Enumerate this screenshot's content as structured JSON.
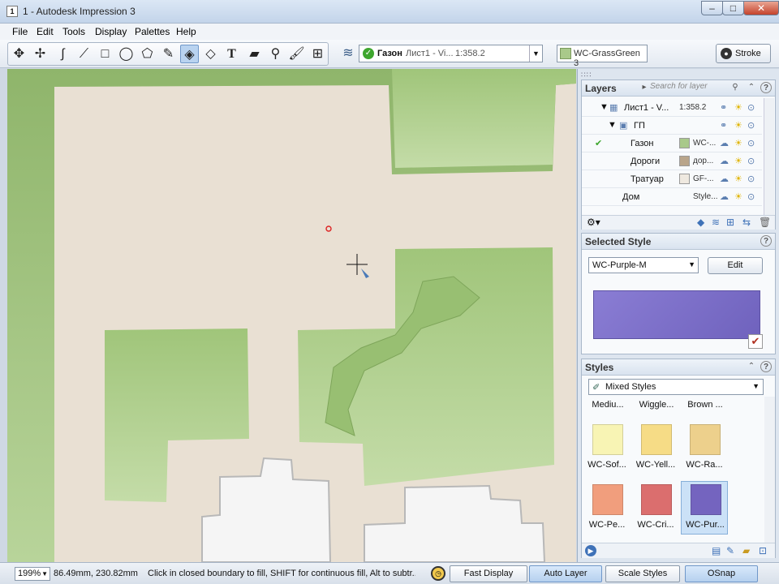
{
  "window": {
    "title": "1 - Autodesk Impression 3",
    "min": "–",
    "max": "□",
    "close": "✕",
    "app_glyph": "1"
  },
  "menu": [
    "File",
    "Edit",
    "Tools",
    "Display",
    "Palettes",
    "Help"
  ],
  "toolbar": {
    "tools": [
      "select-arrow-icon",
      "node-edit-icon",
      "freehand-curve-icon",
      "line-icon",
      "rectangle-icon",
      "ellipse-icon",
      "polygon-icon",
      "pen-icon",
      "paint-bucket-icon",
      "fill-cross-icon",
      "text-icon",
      "eraser-icon",
      "zoom-icon",
      "brush-icon",
      "align-icon"
    ],
    "layer_combo": {
      "name": "Газон",
      "sheet": "Лист1 - Vi...",
      "scale": "1:358.2"
    },
    "style_name": "WC-GrassGreen 3",
    "stroke_label": "Stroke"
  },
  "layers": {
    "title": "Layers",
    "search_placeholder": "Search for layer",
    "rows": [
      {
        "name": "Лист1 - V...",
        "style": "1:358.2",
        "indent": 0,
        "swatch": ""
      },
      {
        "name": "ГП",
        "style": "",
        "indent": 1,
        "swatch": ""
      },
      {
        "name": "Газон",
        "style": "WC-...",
        "indent": 2,
        "swatch": "#a9c98a",
        "active": true
      },
      {
        "name": "Дороги",
        "style": "дор...",
        "indent": 2,
        "swatch": "#b9a58b"
      },
      {
        "name": "Тратуар",
        "style": "GF-...",
        "indent": 2,
        "swatch": "#efe9e0"
      },
      {
        "name": "Дом",
        "style": "Style...",
        "indent": 1,
        "swatch": ""
      }
    ]
  },
  "selected_style": {
    "title": "Selected Style",
    "value": "WC-Purple-M",
    "edit_label": "Edit",
    "color": "#7a6dca"
  },
  "styles": {
    "title": "Styles",
    "combo": "Mixed Styles",
    "top_labels": [
      "Mediu...",
      "Wiggle...",
      "Brown ..."
    ],
    "items": [
      {
        "label": "WC-Sof...",
        "color": "#f8f4b4"
      },
      {
        "label": "WC-Yell...",
        "color": "#f6dc86"
      },
      {
        "label": "WC-Ra...",
        "color": "#edd08c"
      },
      {
        "label": "WC-Pe...",
        "color": "#f19e7d"
      },
      {
        "label": "WC-Cri...",
        "color": "#db6e6e"
      },
      {
        "label": "WC-Pur...",
        "color": "#7464bf",
        "selected": true
      }
    ]
  },
  "status": {
    "zoom": "199%",
    "coords": "86.49mm, 230.82mm",
    "message": "Click in closed boundary to fill, SHIFT for continuous fill, Alt to subtr...",
    "buttons": [
      {
        "label": "Fast Display",
        "on": false
      },
      {
        "label": "Auto Layer",
        "on": true
      },
      {
        "label": "Scale Styles",
        "on": false
      },
      {
        "label": "OSnap",
        "on": true
      }
    ]
  }
}
